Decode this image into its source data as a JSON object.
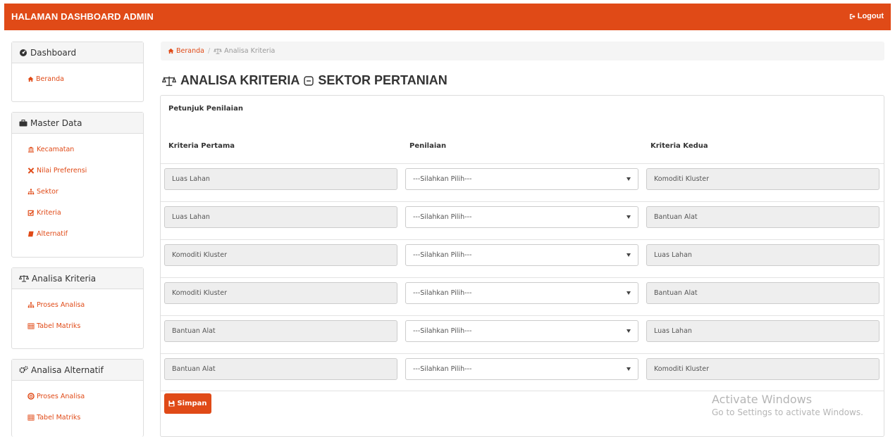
{
  "header": {
    "brand": "HALAMAN DASHBOARD ADMIN",
    "logout_label": "Logout"
  },
  "sidebar": {
    "panels": [
      {
        "title": "Dashboard",
        "icon": "tachometer-icon",
        "items": [
          {
            "label": "Beranda",
            "icon": "home-icon"
          }
        ]
      },
      {
        "title": "Master Data",
        "icon": "briefcase-icon",
        "items": [
          {
            "label": "Kecamatan",
            "icon": "bank-icon"
          },
          {
            "label": "Nilai Preferensi",
            "icon": "sort-icon"
          },
          {
            "label": "Sektor",
            "icon": "sitemap-icon"
          },
          {
            "label": "Kriteria",
            "icon": "check-square-icon"
          },
          {
            "label": "Alternatif",
            "icon": "book-icon"
          }
        ]
      },
      {
        "title": "Analisa Kriteria",
        "icon": "balance-scale-icon",
        "items": [
          {
            "label": "Proses Analisa",
            "icon": "sitemap-icon"
          },
          {
            "label": "Tabel Matriks",
            "icon": "table-icon"
          }
        ]
      },
      {
        "title": "Analisa Alternatif",
        "icon": "cogs-icon",
        "items": [
          {
            "label": "Proses Analisa",
            "icon": "life-ring-icon"
          },
          {
            "label": "Tabel Matriks",
            "icon": "table-icon"
          }
        ]
      }
    ]
  },
  "breadcrumb": {
    "home": "Beranda",
    "separator": "/",
    "current": "Analisa Kriteria"
  },
  "page": {
    "title_main": "ANALISA KRITERIA",
    "title_sub": "SEKTOR PERTANIAN"
  },
  "form": {
    "petunjuk": "Petunjuk Penilaian",
    "col_first": "Kriteria Pertama",
    "col_rating": "Penilaian",
    "col_second": "Kriteria Kedua",
    "rows": [
      {
        "first": "Luas Lahan",
        "rating": "---Silahkan Pilih---",
        "second": "Komoditi Kluster"
      },
      {
        "first": "Luas Lahan",
        "rating": "---Silahkan Pilih---",
        "second": "Bantuan Alat"
      },
      {
        "first": "Komoditi Kluster",
        "rating": "---Silahkan Pilih---",
        "second": "Luas Lahan"
      },
      {
        "first": "Komoditi Kluster",
        "rating": "---Silahkan Pilih---",
        "second": "Bantuan Alat"
      },
      {
        "first": "Bantuan Alat",
        "rating": "---Silahkan Pilih---",
        "second": "Luas Lahan"
      },
      {
        "first": "Bantuan Alat",
        "rating": "---Silahkan Pilih---",
        "second": "Komoditi Kluster"
      }
    ],
    "save_label": "Simpan"
  },
  "watermark": {
    "line1": "Activate Windows",
    "line2": "Go to Settings to activate Windows."
  },
  "colors": {
    "accent": "#e04a17",
    "panel_head": "#f5f5f5",
    "readonly_field": "#eeeeee"
  }
}
